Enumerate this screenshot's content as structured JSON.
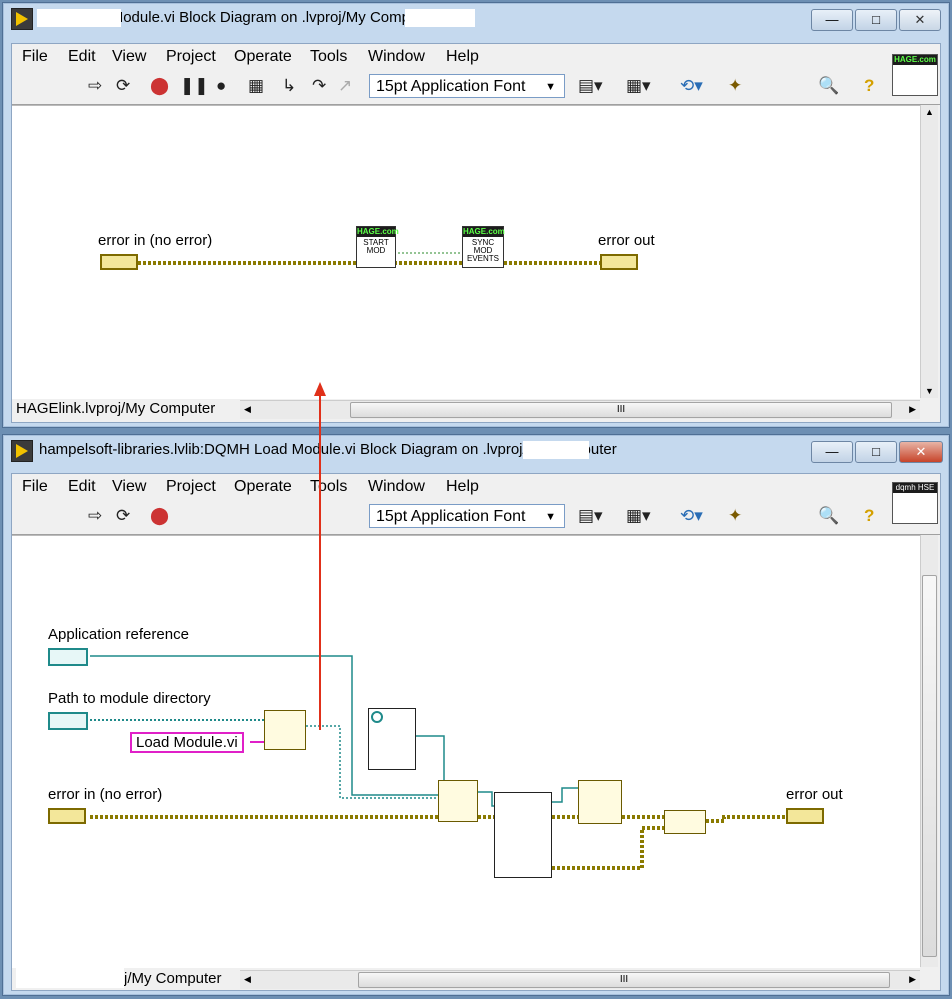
{
  "top_window": {
    "title": ".lvlib:Load Module.vi Block Diagram on  .lvproj/My Computer",
    "menu": [
      "File",
      "Edit",
      "View",
      "Project",
      "Operate",
      "Tools",
      "Window",
      "Help"
    ],
    "font_select": "15pt Application Font",
    "connector_label": "HAGE.com",
    "diagram": {
      "error_in_label": "error in (no error)",
      "error_out_label": "error out",
      "node1": {
        "header": "HAGE.com",
        "text": "START MOD"
      },
      "node2": {
        "header": "HAGE.com",
        "text": "SYNC MOD EVENTS"
      }
    },
    "status_path": "HAGElink.lvproj/My Computer",
    "scroll_center": "III"
  },
  "bottom_window": {
    "title": "hampelsoft-libraries.lvlib:DQMH Load Module.vi Block Diagram on  .lvproj/My Computer",
    "menu": [
      "File",
      "Edit",
      "View",
      "Project",
      "Operate",
      "Tools",
      "Window",
      "Help"
    ],
    "font_select": "15pt Application Font",
    "connector_label": "dqmh HSE",
    "diagram": {
      "app_ref_label": "Application reference",
      "path_label": "Path to module directory",
      "constant_label": "Load Module.vi",
      "error_in_label": "error in (no error)",
      "error_out_label": "error out"
    },
    "status_path": "j/My Computer",
    "scroll_center": "III"
  },
  "colors": {
    "error_wire": "#8a7a00",
    "ref_wire": "#1f8a8a",
    "string_wire": "#e020c8",
    "annotation_arrow": "#e0301a",
    "title_bar": "#c5d9ee"
  },
  "window_buttons": {
    "minimize": "▭",
    "maximize": "□",
    "close": "✕"
  }
}
